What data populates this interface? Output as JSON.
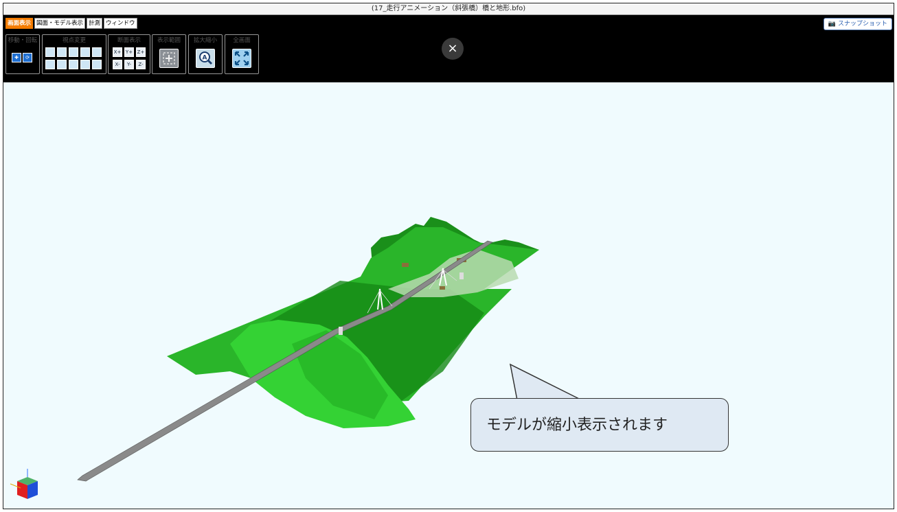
{
  "window": {
    "title": "(17_走行アニメーション（斜張橋）橋と地形.bfo)"
  },
  "menu": {
    "tabs": [
      {
        "label": "画面表示",
        "active": true
      },
      {
        "label": "図面・モデル表示",
        "active": false
      },
      {
        "label": "計測",
        "active": false
      },
      {
        "label": "ウィンドウ",
        "active": false
      }
    ]
  },
  "toolbar": {
    "groups": {
      "move": "移動・回転",
      "viewpoint": "視点変更",
      "section": "断面表示",
      "range": "表示範囲",
      "zoom": "拡大縮小",
      "fullscreen": "全画面"
    },
    "section_buttons": [
      "X+",
      "Y+",
      "Z+",
      "X-",
      "Y-",
      "Z-"
    ]
  },
  "snapshot": {
    "label": "スナップショット",
    "icon": "camera-icon"
  },
  "close": {
    "label": "×"
  },
  "callout": {
    "text": "モデルが縮小表示されます"
  },
  "colors": {
    "accent": "#f57c00",
    "toolbar": "#000000",
    "viewport_bg": "#f0fbfe",
    "terrain": "#1fa51f",
    "callout_bg": "#dfe9f3"
  }
}
